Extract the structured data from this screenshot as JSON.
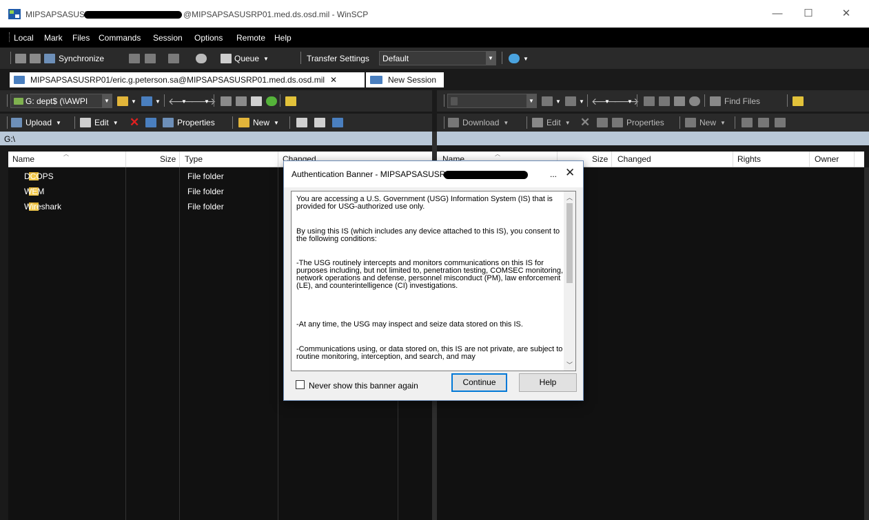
{
  "window": {
    "title_start": "MIPSAPSASUSRP01/",
    "title_end": "@MIPSAPSASUSRP01.med.ds.osd.mil - WinSCP",
    "minimize": "—",
    "maximize": "☐",
    "close": "✕"
  },
  "menu": {
    "items": [
      "Local",
      "Mark",
      "Files",
      "Commands",
      "Session",
      "Options",
      "Remote",
      "Help"
    ]
  },
  "toolbar": {
    "synchronize": "Synchronize",
    "queue": "Queue",
    "transfer_settings_label": "Transfer Settings",
    "transfer_settings_value": "Default"
  },
  "tabs": {
    "session": "MIPSAPSASUSRP01/eric.g.peterson.sa@MIPSAPSASUSRP01.med.ds.osd.mil",
    "session_close": "✕",
    "new_session": "New Session"
  },
  "local": {
    "drive": "G: dept$ (\\\\AWPI",
    "path": "G:\\",
    "upload": "Upload",
    "edit": "Edit",
    "properties": "Properties",
    "new": "New",
    "columns": [
      "Name",
      "Size",
      "Type",
      "Changed"
    ],
    "rows": [
      {
        "name": "DCOPS",
        "type": "File folder"
      },
      {
        "name": "WEM",
        "type": "File folder"
      },
      {
        "name": "Wireshark",
        "type": "File folder"
      }
    ]
  },
  "remote": {
    "find_files": "Find Files",
    "download": "Download",
    "edit": "Edit",
    "properties": "Properties",
    "new": "New",
    "columns": [
      "Name",
      "Size",
      "Changed",
      "Rights",
      "Owner"
    ]
  },
  "dialog": {
    "title": "Authentication Banner - MIPSAPSASUSRP01/",
    "title_ellipsis": "...",
    "close": "✕",
    "paragraphs": [
      "You are accessing a U.S. Government (USG) Information System (IS) that is provided for USG-authorized use only.",
      "By using this IS (which includes any device attached to this IS), you consent to the following conditions:",
      "-The USG routinely intercepts and monitors communications on this IS for purposes including, but not limited to, penetration testing, COMSEC monitoring, network operations and defense, personnel misconduct (PM), law enforcement (LE), and counterintelligence (CI) investigations.",
      "-At any time, the USG may inspect and seize data stored on this IS.",
      "-Communications using, or data stored on, this IS are not private, are subject to routine monitoring, interception, and search, and may"
    ],
    "checkbox_label": "Never show this banner again",
    "continue": "Continue",
    "help": "Help"
  }
}
